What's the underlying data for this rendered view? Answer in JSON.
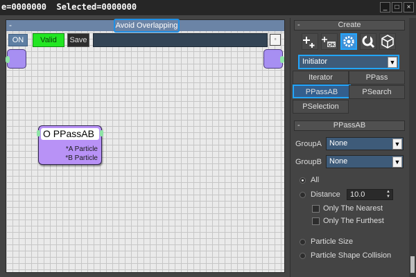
{
  "window": {
    "title": "e=0000000  Selected=0000000",
    "btn_min": "_",
    "btn_max": "□",
    "btn_close": "×"
  },
  "view": {
    "collapse": "-",
    "title": "Avoid Overlapping",
    "toolbar": {
      "on_label": "ON",
      "valid_label": "Valid",
      "save_label": "Save",
      "field_value": "",
      "small_btn": "▫"
    },
    "node": {
      "title": "O PPassAB",
      "outputs": [
        "*A Particle",
        "*B Particle"
      ]
    }
  },
  "create": {
    "header": "Create",
    "collapse": "-",
    "icons": [
      {
        "name": "add-operator-icon",
        "glyph": "✚"
      },
      {
        "name": "ok-icon",
        "glyph": "OK"
      },
      {
        "name": "gear-icon",
        "glyph": "⚙"
      },
      {
        "name": "wrench-icon",
        "glyph": "🔧"
      },
      {
        "name": "cube-icon",
        "glyph": "◆"
      }
    ],
    "active_icon": "gear-icon",
    "dropdown_value": "Initiator",
    "buttons": [
      "Iterator",
      "PPass",
      "PPassAB",
      "PSearch",
      "PSelection"
    ],
    "selected_button": "PPassAB"
  },
  "ppassab": {
    "header": "PPassAB",
    "collapse": "-",
    "groupA_label": "GroupA",
    "groupA_value": "None",
    "groupB_label": "GroupB",
    "groupB_value": "None",
    "all_label": "All",
    "distance_label": "Distance",
    "distance_value": "10.0",
    "nearest_label": "Only The Nearest",
    "furthest_label": "Only The Furthest",
    "particle_size_label": "Particle Size",
    "shape_collision_label": "Particle Shape Collision",
    "selected_mode": "All"
  }
}
